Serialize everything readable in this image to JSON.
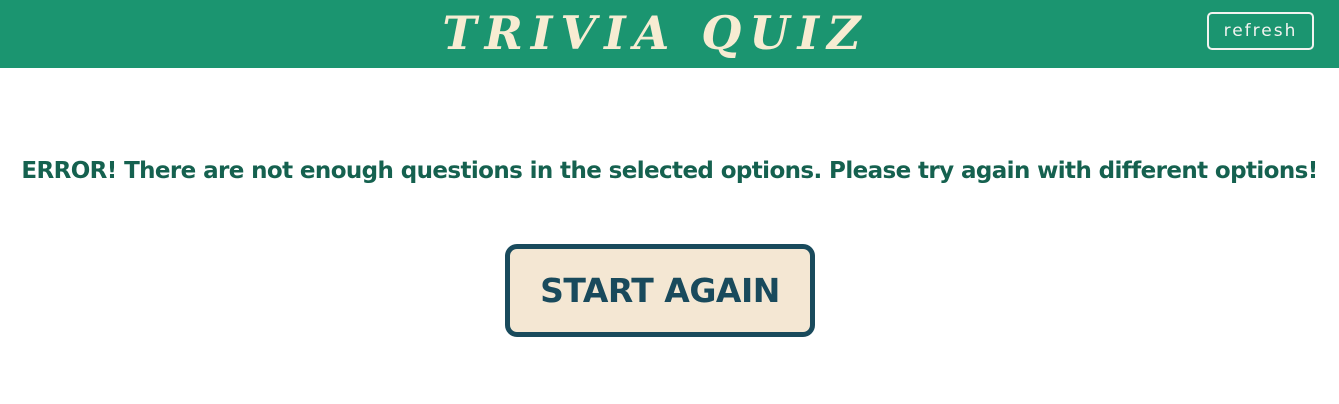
{
  "header": {
    "title": "TRIVIA QUIZ",
    "refresh_label": "refresh"
  },
  "main": {
    "error_message": "ERROR! There are not enough questions in the selected options. Please try again with different options!",
    "start_again_label": "START AGAIN"
  },
  "colors": {
    "header_bg": "#1b9570",
    "title_text": "#f7ecd2",
    "error_text": "#15614f",
    "button_border": "#194a5c",
    "button_bg": "#f4e7d3"
  }
}
